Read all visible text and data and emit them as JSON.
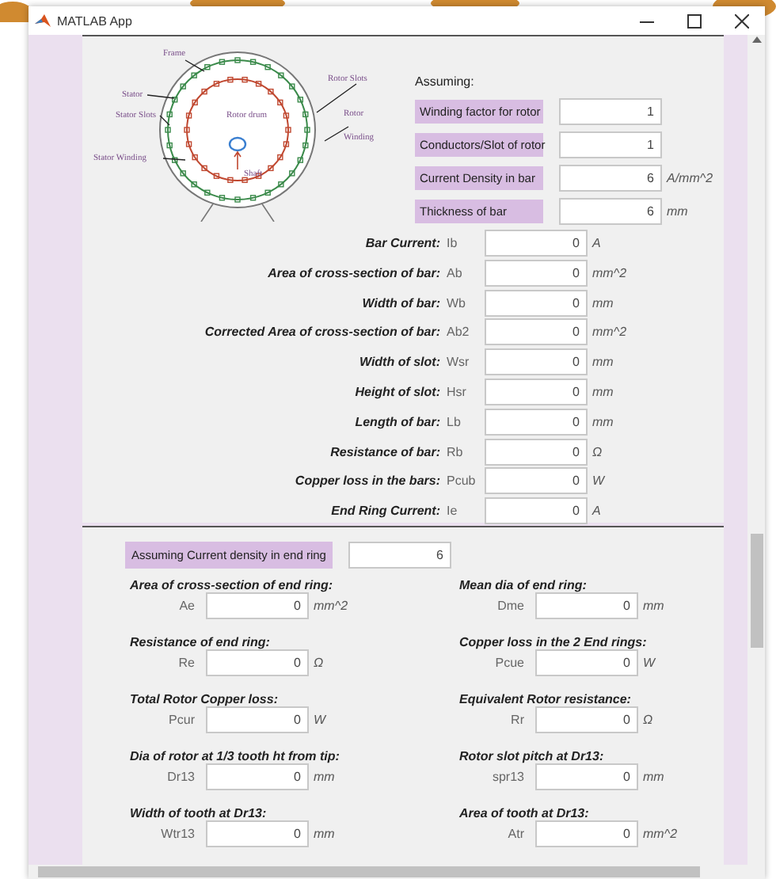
{
  "window": {
    "title": "MATLAB App"
  },
  "diagram": {
    "labels": [
      {
        "text": "Frame"
      },
      {
        "text": "Stator"
      },
      {
        "text": "Stator Slots"
      },
      {
        "text": "Stator Winding"
      },
      {
        "text": "Rotor drum"
      },
      {
        "text": "Shaft"
      },
      {
        "text": "Rotor Slots"
      },
      {
        "text": "Rotor"
      },
      {
        "text": "Winding"
      }
    ]
  },
  "assumptions": {
    "heading": "Assuming:",
    "fields": [
      {
        "label": "Winding factor for rotor",
        "value": "1"
      },
      {
        "label": "Conductors/Slot of rotor",
        "value": "1"
      },
      {
        "label": "Current Density in bar",
        "value": "6",
        "unit": "A/mm^2"
      },
      {
        "label": "Thickness of bar",
        "value": "6",
        "unit": "mm"
      }
    ]
  },
  "bar_results": [
    {
      "label": "Bar Current:",
      "symbol": "Ib",
      "value": "0",
      "unit": "A"
    },
    {
      "label": "Area of cross-section of bar:",
      "symbol": "Ab",
      "value": "0",
      "unit": "mm^2"
    },
    {
      "label": "Width of bar:",
      "symbol": "Wb",
      "value": "0",
      "unit": "mm"
    },
    {
      "label": "Corrected Area of cross-section of bar:",
      "symbol": "Ab2",
      "value": "0",
      "unit": "mm^2"
    },
    {
      "label": "Width of slot:",
      "symbol": "Wsr",
      "value": "0",
      "unit": "mm"
    },
    {
      "label": "Height of slot:",
      "symbol": "Hsr",
      "value": "0",
      "unit": "mm"
    },
    {
      "label": "Length of bar:",
      "symbol": "Lb",
      "value": "0",
      "unit": "mm"
    },
    {
      "label": "Resistance of bar:",
      "symbol": "Rb",
      "value": "0",
      "unit": "Ω"
    },
    {
      "label": "Copper loss in the bars:",
      "symbol": "Pcub",
      "value": "0",
      "unit": "W"
    },
    {
      "label": "End Ring Current:",
      "symbol": "Ie",
      "value": "0",
      "unit": "A"
    }
  ],
  "end_ring": {
    "assumption": {
      "label": "Assuming Current density in end ring",
      "value": "6"
    },
    "results": [
      {
        "label": "Area of cross-section of end ring:",
        "symbol": "Ae",
        "value": "0",
        "unit": "mm^2"
      },
      {
        "label": "Mean dia of end ring:",
        "symbol": "Dme",
        "value": "0",
        "unit": "mm"
      },
      {
        "label": "Resistance of end ring:",
        "symbol": "Re",
        "value": "0",
        "unit": "Ω"
      },
      {
        "label": "Copper loss in the 2 End rings:",
        "symbol": "Pcue",
        "value": "0",
        "unit": "W"
      },
      {
        "label": "Total Rotor Copper loss:",
        "symbol": "Pcur",
        "value": "0",
        "unit": "W"
      },
      {
        "label": "Equivalent Rotor resistance:",
        "symbol": "Rr",
        "value": "0",
        "unit": "Ω"
      },
      {
        "label": "Dia of rotor at 1/3 tooth ht from tip:",
        "symbol": "Dr13",
        "value": "0",
        "unit": "mm"
      },
      {
        "label": "Rotor slot pitch at Dr13:",
        "symbol": "spr13",
        "value": "0",
        "unit": "mm"
      },
      {
        "label": "Width of tooth at Dr13:",
        "symbol": "Wtr13",
        "value": "0",
        "unit": "mm"
      },
      {
        "label": "Area of tooth at Dr13:",
        "symbol": "Atr",
        "value": "0",
        "unit": "mm^2"
      }
    ]
  }
}
